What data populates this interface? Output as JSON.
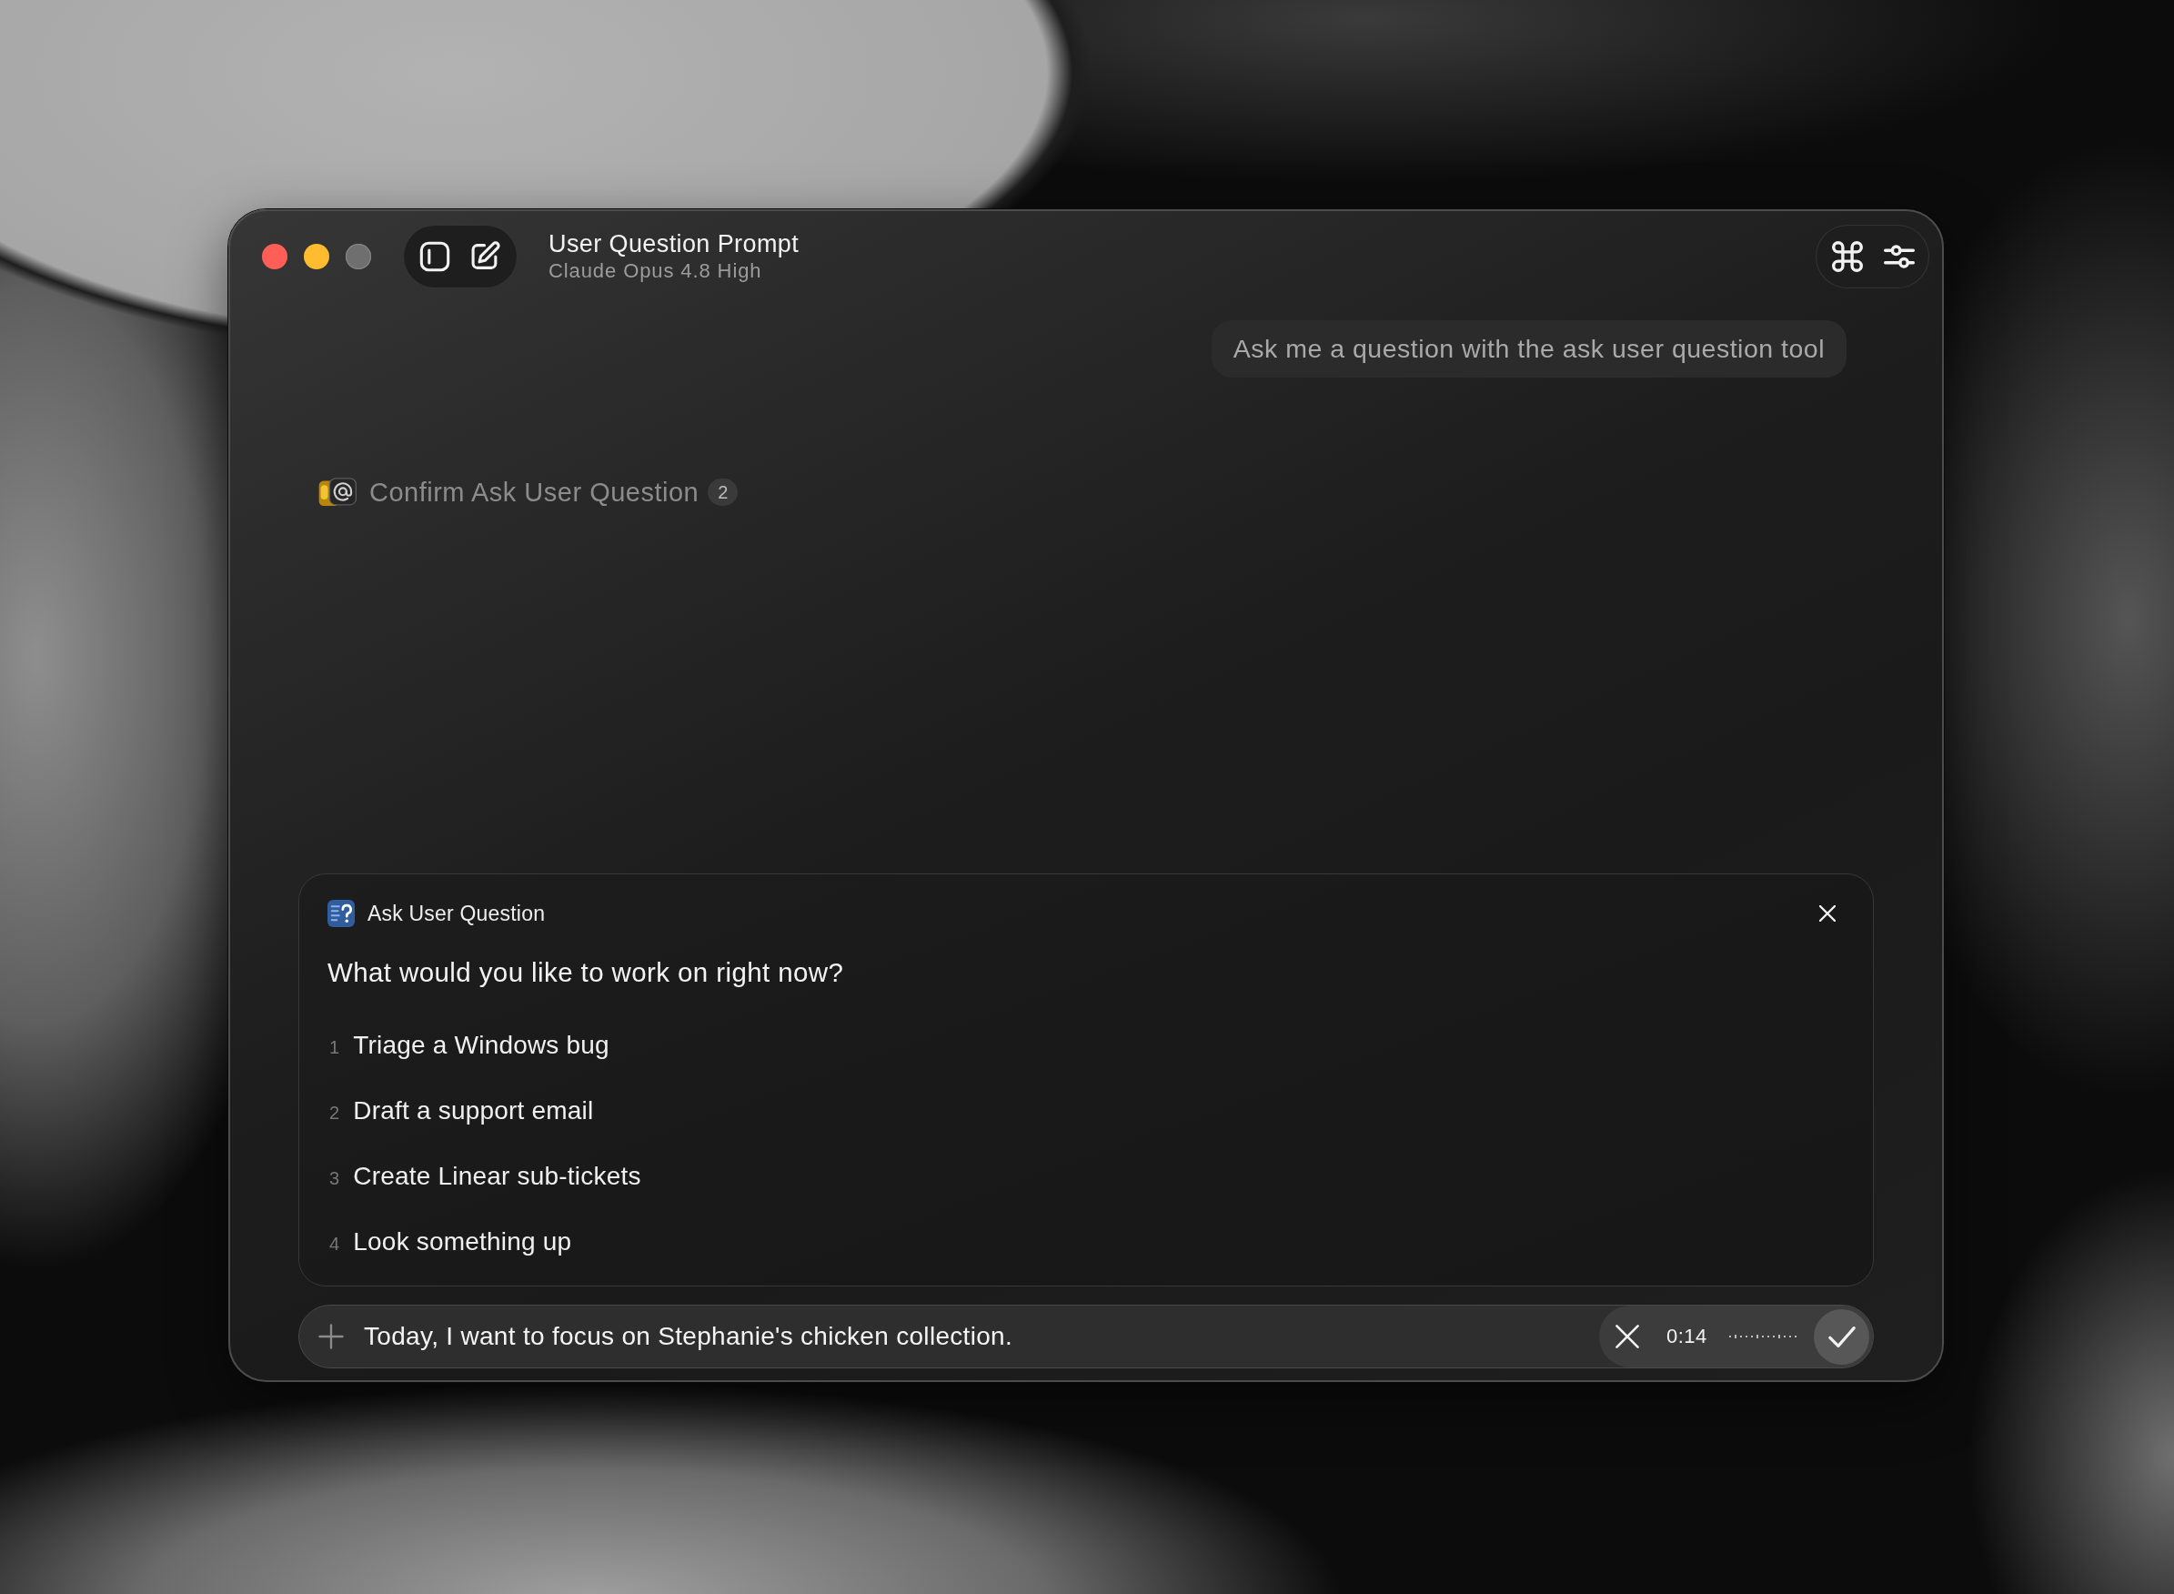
{
  "window": {
    "window_controls": [
      {
        "kind": "close",
        "disabled": false
      },
      {
        "kind": "minimize",
        "disabled": false
      },
      {
        "kind": "zoom",
        "disabled": true
      }
    ],
    "title": "User Question Prompt",
    "subtitle": "Claude Opus 4.8 High"
  },
  "conversation": {
    "user_message": "Ask me a question with the ask user question tool",
    "tool_call": {
      "label": "Confirm Ask User Question",
      "count": "2"
    }
  },
  "question_card": {
    "title": "Ask User Question",
    "question": "What would you like to work on right now?",
    "options": [
      {
        "number": "1",
        "label": "Triage a Windows bug",
        "selected": false
      },
      {
        "number": "2",
        "label": "Draft a support email",
        "selected": false
      },
      {
        "number": "3",
        "label": "Create Linear sub-tickets",
        "selected": false
      },
      {
        "number": "4",
        "label": "Look something up",
        "selected": false
      }
    ]
  },
  "composer": {
    "value": "Today, I want to focus on Stephanie's chicken collection.",
    "recording": {
      "time": "0:14"
    }
  }
}
